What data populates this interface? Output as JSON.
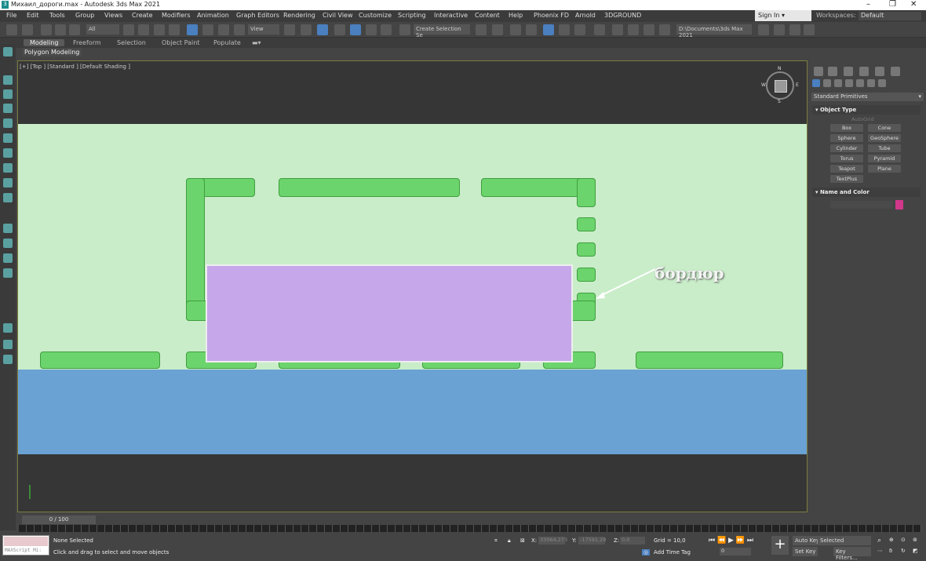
{
  "window": {
    "title": "Михаил_дороги.max - Autodesk 3ds Max 2021",
    "controls": [
      "–",
      "❐",
      "✕"
    ]
  },
  "menu": [
    "File",
    "Edit",
    "Tools",
    "Group",
    "Views",
    "Create",
    "Modifiers",
    "Animation",
    "Graph Editors",
    "Rendering",
    "Civil View",
    "Customize",
    "Scripting",
    "Interactive",
    "Content",
    "Help",
    "Phoenix FD",
    "Arnold",
    "3DGROUND"
  ],
  "account": {
    "sign_in": "Sign In",
    "workspaces_label": "Workspaces:",
    "workspace": "Default"
  },
  "toolbar": {
    "selection_filter": "All",
    "ref_coord": "View",
    "named_selection": "Create Selection Se",
    "project_path": "D:\\Documents\\3ds Max 2021"
  },
  "ribbon": {
    "tabs": [
      "Modeling",
      "Freeform",
      "Selection",
      "Object Paint",
      "Populate"
    ],
    "panel": "Polygon Modeling"
  },
  "viewport": {
    "label": "[+] [Top ] [Standard ] [Default Shading ]",
    "annotation": "бордюр",
    "colors": {
      "ground": "#c9edc9",
      "curb": "#6cd46c",
      "lot": "#c5a7ea",
      "water": "#6aa2d4"
    },
    "compass": [
      "N",
      "W",
      "E",
      "S"
    ]
  },
  "command_panel": {
    "dropdown": "Standard Primitives",
    "object_type": "Object Type",
    "autogrid": "AutoGrid",
    "buttons": [
      "Box",
      "Cone",
      "Sphere",
      "GeoSphere",
      "Cylinder",
      "Tube",
      "Torus",
      "Pyramid",
      "Teapot",
      "Plane",
      "TextPlus"
    ],
    "name_and_color": "Name and Color",
    "color": "#d1378a"
  },
  "timeline": {
    "frame": "0 / 100"
  },
  "status": {
    "maxscript": "MAXScript Mi:",
    "selection": "None Selected",
    "prompt": "Click and drag to select and move objects",
    "x_label": "X:",
    "x": "33064,273",
    "y_label": "Y:",
    "y": "-17591,29",
    "z_label": "Z:",
    "z": "0,0",
    "grid": "Grid = 10,0",
    "add_time_tag": "Add Time Tag",
    "frame_field": "0",
    "auto_key": "Auto Key",
    "set_key": "Set Key",
    "key_mode": "Selected",
    "key_filters": "Key Filters..."
  }
}
